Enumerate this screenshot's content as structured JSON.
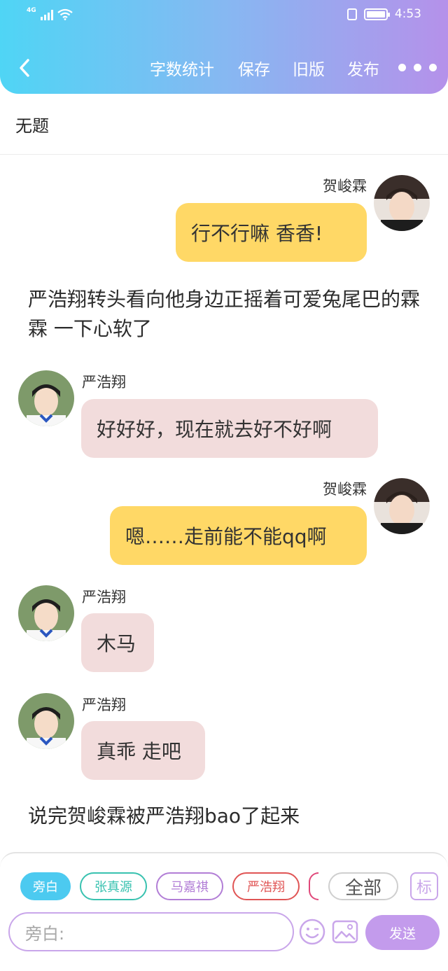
{
  "status_bar": {
    "network": "4G",
    "time": "4:53"
  },
  "toolbar": {
    "word_count": "字数统计",
    "save": "保存",
    "old_version": "旧版",
    "publish": "发布"
  },
  "document": {
    "title": "无题"
  },
  "messages": [
    {
      "speaker": "贺峻霖",
      "text": "行不行嘛 香香!"
    },
    {
      "narration": "严浩翔转头看向他身边正摇着可爱兔尾巴的霖霖 一下心软了"
    },
    {
      "speaker": "严浩翔",
      "text": "好好好，现在就去好不好啊"
    },
    {
      "speaker": "贺峻霖",
      "text": "嗯……走前能不能qq啊"
    },
    {
      "speaker": "严浩翔",
      "text": "木马"
    },
    {
      "speaker": "严浩翔",
      "text": "真乖 走吧"
    },
    {
      "narration": "说完贺峻霖被严浩翔bao了起来"
    }
  ],
  "role_chips": [
    {
      "label": "旁白",
      "color": "#4ccaf0"
    },
    {
      "label": "张真源",
      "color": "#39c2b0"
    },
    {
      "label": "马嘉祺",
      "color": "#b27ed6"
    },
    {
      "label": "严浩翔",
      "color": "#e05555"
    }
  ],
  "all_button": "全部",
  "tag_button": "标",
  "input": {
    "placeholder": "旁白:"
  },
  "send_button": "发送",
  "icons": {
    "back": "chevron-left-icon",
    "more": "more-dots-icon",
    "emoji": "emoji-icon",
    "image": "image-icon"
  }
}
